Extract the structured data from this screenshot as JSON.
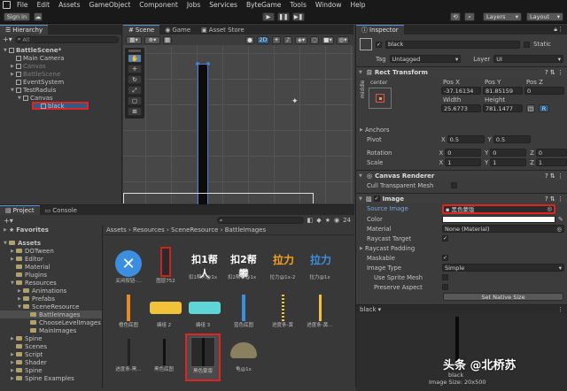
{
  "menu": [
    "File",
    "Edit",
    "Assets",
    "GameObject",
    "Component",
    "Jobs",
    "Services",
    "ByteGame",
    "Tools",
    "Window",
    "Help"
  ],
  "toolbar": {
    "signin": "Sign in",
    "layers": "Layers",
    "layout": "Layout",
    "play": "▶",
    "pause": "❚❚",
    "step": "▶❚"
  },
  "hierarchy": {
    "tab": "Hierarchy",
    "search_placeholder": "All",
    "items": [
      {
        "label": "BattleScene*",
        "level": 0
      },
      {
        "label": "Main Camera",
        "level": 1
      },
      {
        "label": "Canvas",
        "level": 1
      },
      {
        "label": "BattleScene",
        "level": 1
      },
      {
        "label": "EventSystem",
        "level": 1
      },
      {
        "label": "TestRaduis",
        "level": 1
      },
      {
        "label": "Canvas",
        "level": 2
      },
      {
        "label": "black",
        "level": 3
      }
    ]
  },
  "scene": {
    "tabs": [
      "Scene",
      "Game",
      "Asset Store"
    ],
    "mode": "2D"
  },
  "project": {
    "tabs": [
      "Project",
      "Console"
    ],
    "favorites": "Favorites",
    "breadcrumb": [
      "Assets",
      "Resources",
      "SceneResource",
      "BattleImages"
    ],
    "count": "24",
    "tree": [
      "Assets",
      "DOTween",
      "Editor",
      "Material",
      "Plugins",
      "Resources",
      "Animations",
      "Prefabs",
      "SceneResource",
      "BattleImages",
      "ChooseLevelImages",
      "MainImages",
      "Spine",
      "Scenes",
      "Script",
      "Shader",
      "Spine",
      "Spine Examples"
    ],
    "assets_row1": [
      "关闭按钮-…",
      "图层752",
      "扣1帮人@1x",
      "扣2帮攀@1x",
      "拉力@1x-2",
      "拉力@1x"
    ],
    "assets_row2": [
      "橙色底图",
      "编组 2",
      "编组 3",
      "蓝色底图",
      "进度条-黄",
      "进度条-黄…"
    ],
    "assets_row3": [
      "进度条-黑…",
      "黑色底图",
      "黑色蒙版",
      "龟@1x"
    ],
    "selected_bottom": "black",
    "image_size": "Image Size: 20x500"
  },
  "inspector": {
    "tab": "Inspector",
    "name": "black",
    "static": "Static",
    "tag_label": "Tag",
    "tag": "Untagged",
    "layer_label": "Layer",
    "layer": "UI",
    "rect": {
      "title": "Rect Transform",
      "anchor": "center",
      "side": "middle",
      "posx_l": "Pos X",
      "posy_l": "Pos Y",
      "posz_l": "Pos Z",
      "posx": "-37.16134",
      "posy": "81.85159",
      "posz": "0",
      "w_l": "Width",
      "h_l": "Height",
      "w": "25.6773",
      "h": "781.1477",
      "anchors": "Anchors",
      "pivot": "Pivot",
      "pivx": "0.5",
      "pivy": "0.5",
      "rotation": "Rotation",
      "rx": "0",
      "ry": "0",
      "rz": "0",
      "scale": "Scale",
      "sx": "1",
      "sy": "1",
      "sz": "1",
      "r_btn": "R"
    },
    "canvas_renderer": {
      "title": "Canvas Renderer",
      "cull": "Cull Transparent Mesh"
    },
    "image": {
      "title": "Image",
      "source_label": "Source Image",
      "source": "黑色蒙版",
      "color_label": "Color",
      "material_label": "Material",
      "material": "None (Material)",
      "raycast": "Raycast Target",
      "padding": "Raycast Padding",
      "maskable": "Maskable",
      "type_label": "Image Type",
      "type": "Simple",
      "use_sprite_mesh": "Use Sprite Mesh",
      "preserve": "Preserve Aspect",
      "set_native": "Set Native Size"
    },
    "preview_label": "black",
    "preview_name": "black"
  },
  "watermark": "头条 @北桥苏",
  "colors": {
    "accent": "#2c5d87",
    "highlight": "#e02424"
  }
}
